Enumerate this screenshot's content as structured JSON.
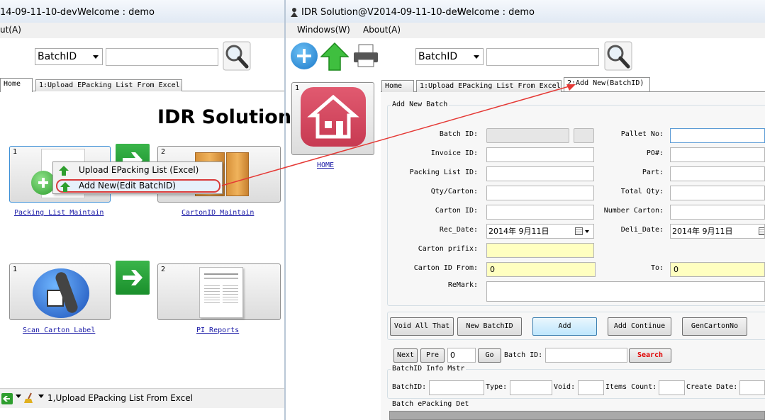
{
  "left_window": {
    "title_fragment": "14-09-11-10-dev",
    "welcome": "Welcome : demo",
    "menu_fragment": "ut(A)",
    "search": {
      "field": "BatchID"
    },
    "tabs": [
      {
        "label": "Home"
      },
      {
        "label": "1:Upload EPacking List From Excel"
      }
    ],
    "heading": "IDR Solution",
    "cards": [
      {
        "num": "1",
        "link": "Packing List Maintain"
      },
      {
        "num": "2",
        "link": "CartonID Maintain"
      },
      {
        "num": "1",
        "link": "Scan Carton Label"
      },
      {
        "num": "2",
        "link": "PI Reports"
      }
    ],
    "context_menu": [
      {
        "label": "Upload EPacking List (Excel)"
      },
      {
        "label": "Add New(Edit BatchID)"
      }
    ],
    "status": "1,Upload EPacking List From Excel"
  },
  "right_window": {
    "title": "IDR Solution@V2014-09-11-10-dev",
    "welcome": "Welcome : demo",
    "menu": [
      "Windows(W)",
      "About(A)"
    ],
    "search": {
      "field": "BatchID"
    },
    "tabs": [
      {
        "label": "Home"
      },
      {
        "label": "1:Upload EPacking List From Excel"
      },
      {
        "label": "2:Add New(BatchID)"
      }
    ],
    "home_card": {
      "num": "1",
      "link": "HOME"
    },
    "form": {
      "group_title": "Add New Batch",
      "left_labels": [
        "Batch ID:",
        "Invoice ID:",
        "Packing List ID:",
        "Qty/Carton:",
        "Carton ID:",
        "Rec_Date:",
        "Carton prifix:",
        "Carton ID From:",
        "ReMark:"
      ],
      "right_labels": [
        "Pallet No:",
        "PO#:",
        "Part:",
        "Total Qty:",
        "Number Carton:",
        "Deli_Date:",
        "To:"
      ],
      "rec_date": "2014年 9月11日",
      "deli_date": "2014年 9月11日",
      "carton_from": "0",
      "carton_to": "0"
    },
    "buttons": [
      "Void All That",
      "New BatchID",
      "Add",
      "Add Continue",
      "GenCartonNo"
    ],
    "nav": {
      "next": "Next",
      "pre": "Pre",
      "page": "0",
      "go": "Go",
      "batch_label": "Batch ID:",
      "search": "Search"
    },
    "info": {
      "title": "BatchID Info Mstr",
      "labels": [
        "BatchID:",
        "Type:",
        "Void:",
        "Items Count:",
        "Create Date:"
      ]
    },
    "det_title": "Batch ePacking Det"
  },
  "colors": {
    "arrow": "#e53935",
    "accent_blue": "#2b8fd6",
    "home_tile": "#d6455d"
  }
}
